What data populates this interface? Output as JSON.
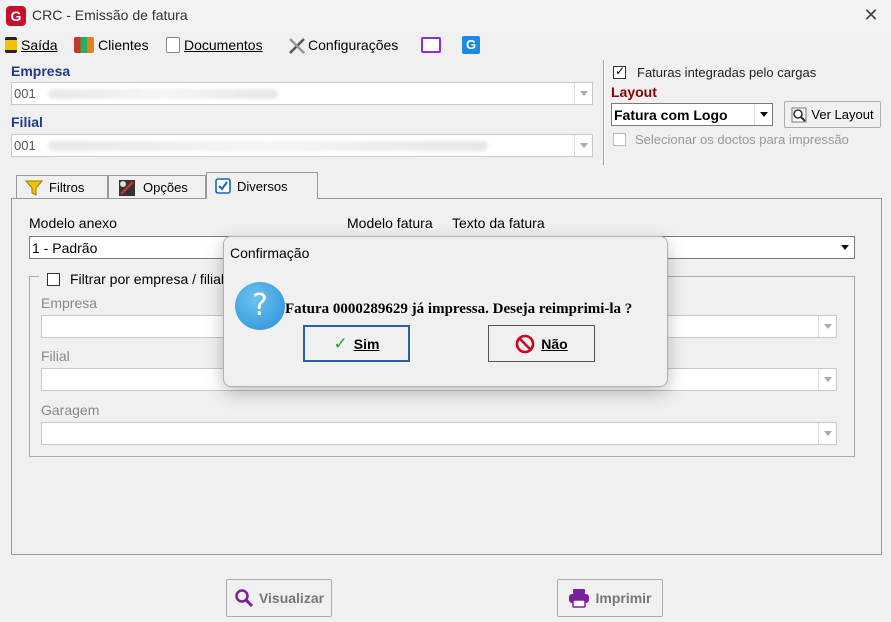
{
  "window": {
    "title": "CRC - Emissão de fatura",
    "close_glyph": "✕",
    "app_icon_letter": "G"
  },
  "menu": {
    "items": [
      {
        "label": "Saída",
        "icon": "exit-door-icon",
        "underline": "S"
      },
      {
        "label": "Clientes",
        "icon": "clients-icon",
        "underline": "C"
      },
      {
        "label": "Documentos",
        "icon": "documents-icon",
        "underline": "D"
      },
      {
        "label": "Configurações",
        "icon": "tools-icon",
        "underline": "C"
      }
    ],
    "monitor_icon": "monitor-icon",
    "g_icon": "g-logo-icon"
  },
  "empresa": {
    "label": "Empresa",
    "value": "001"
  },
  "filial": {
    "label": "Filial",
    "value": "001"
  },
  "right": {
    "faturas_integradas_label": "Faturas integradas pelo cargas",
    "faturas_integradas_checked": true,
    "layout_label": "Layout",
    "layout_value": "Fatura com Logo",
    "ver_layout_label": "Ver Layout",
    "selecionar_label": "Selecionar os doctos para impressão",
    "selecionar_checked": false
  },
  "tabs": [
    {
      "label": "Filtros",
      "icon": "filter-funnel-icon"
    },
    {
      "label": "Opções",
      "icon": "options-icon"
    },
    {
      "label": "Diversos",
      "icon": "check-square-icon",
      "active": true
    }
  ],
  "diversos": {
    "modelo_anexo_label": "Modelo anexo",
    "modelo_anexo_value": "1 - Padrão",
    "modelo_fatura_label": "Modelo fatura",
    "texto_fatura_label": "Texto da fatura",
    "filtrar_label": "Filtrar por empresa / filial e",
    "filtrar_checked": false,
    "empresa_label": "Empresa",
    "filial_label": "Filial",
    "garagem_label": "Garagem"
  },
  "dialog": {
    "title": "Confirmação",
    "icon_glyph": "?",
    "message": "Fatura 0000289629 já impressa. Deseja reimprimi-la ?",
    "yes_label": "Sim",
    "yes_glyph": "✓",
    "no_label": "Não",
    "no_glyph": "⊘"
  },
  "footer": {
    "visualizar_label": "Visualizar",
    "visualizar_glyph": "🔍",
    "imprimir_label": "Imprimir",
    "imprimir_glyph": "🖶"
  },
  "colors": {
    "label_blue": "#1f3a8a",
    "layout_red": "#8b0000",
    "dialog_focus": "#2b5fa8",
    "no_red": "#d0021b",
    "yes_green": "#2e9e2e"
  }
}
